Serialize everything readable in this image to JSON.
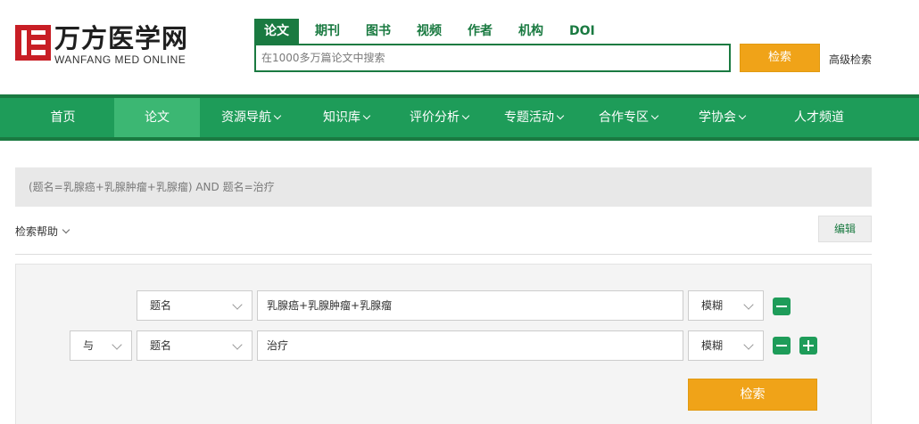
{
  "logo": {
    "name_cn": "万方医学网",
    "name_en": "WANFANG MED ONLINE"
  },
  "search": {
    "tabs": [
      "论文",
      "期刊",
      "图书",
      "视频",
      "作者",
      "机构",
      "DOI"
    ],
    "active_tab": "论文",
    "placeholder": "在1000多万篇论文中搜索",
    "button_label": "检索",
    "advanced_label": "高级检索"
  },
  "nav": {
    "items": [
      {
        "label": "首页",
        "has_dropdown": false
      },
      {
        "label": "论文",
        "has_dropdown": false,
        "active": true
      },
      {
        "label": "资源导航",
        "has_dropdown": true
      },
      {
        "label": "知识库",
        "has_dropdown": true
      },
      {
        "label": "评价分析",
        "has_dropdown": true
      },
      {
        "label": "专题活动",
        "has_dropdown": true
      },
      {
        "label": "合作专区",
        "has_dropdown": true
      },
      {
        "label": "学协会",
        "has_dropdown": true
      },
      {
        "label": "人才频道",
        "has_dropdown": false
      }
    ]
  },
  "query": {
    "expression": "(题名=乳腺癌+乳腺肿瘤+乳腺瘤) AND 题名=治疗",
    "help_label": "检索帮助",
    "edit_label": "编辑"
  },
  "form": {
    "rows": [
      {
        "field": "题名",
        "value": "乳腺癌+乳腺肿瘤+乳腺瘤",
        "match": "模糊"
      },
      {
        "logic": "与",
        "field": "题名",
        "value": "治疗",
        "match": "模糊"
      }
    ],
    "submit_label": "检索"
  },
  "colors": {
    "brand_green": "#1a7a41",
    "nav_green": "#1e9c59",
    "accent_orange": "#f0a318",
    "logo_red": "#c81e25"
  }
}
